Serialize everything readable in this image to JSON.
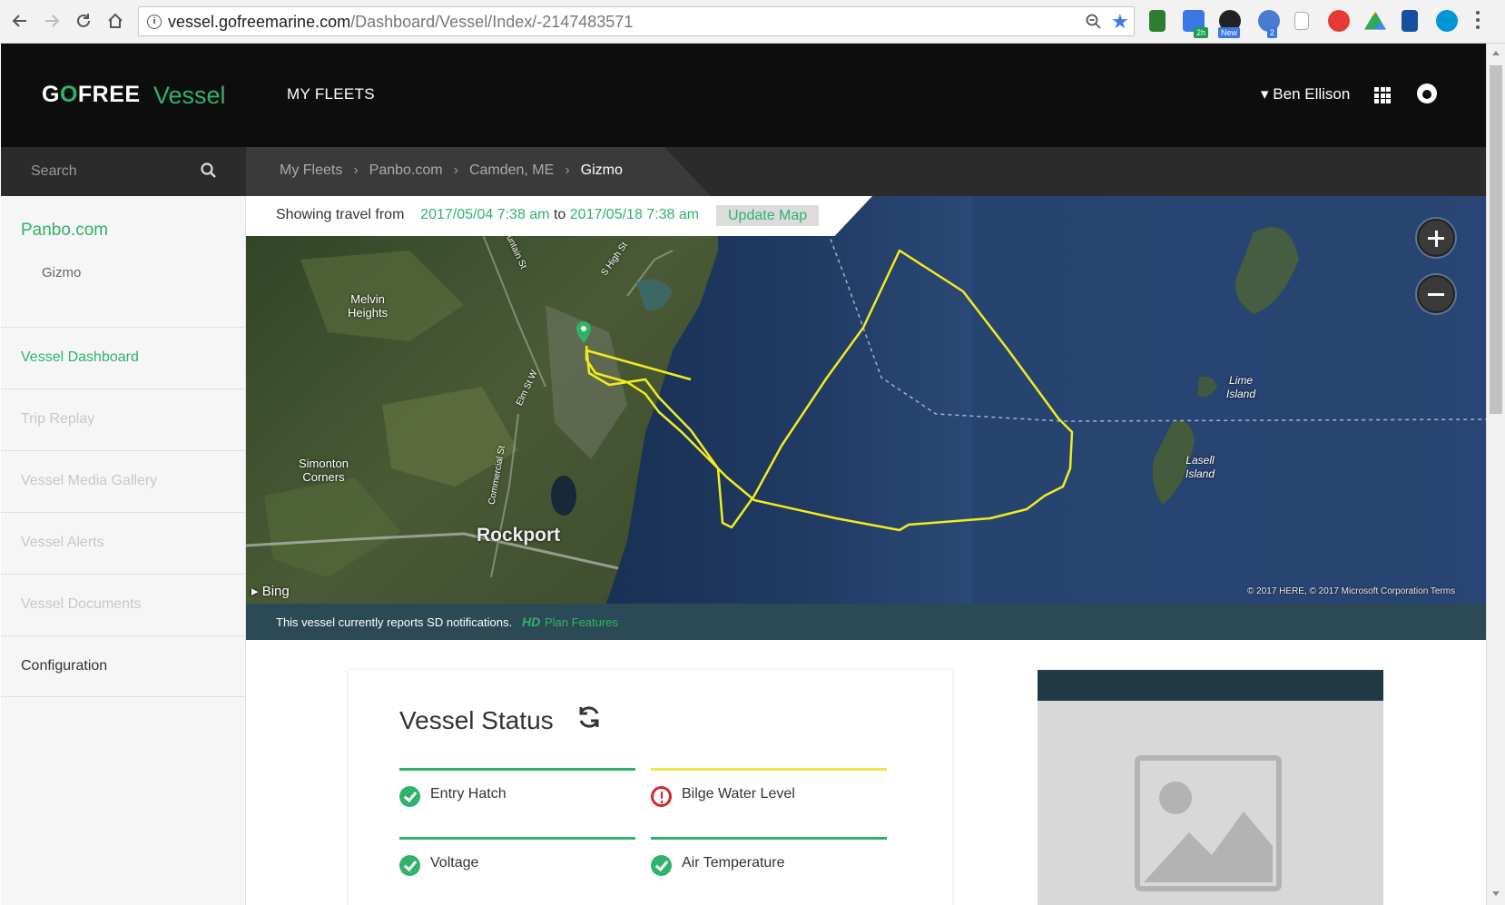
{
  "browser": {
    "url_host": "vessel.gofreemarine.com",
    "url_path": "/Dashboard/Vessel/Index/-2147483571",
    "extension_badges": [
      "2h",
      "New",
      "2"
    ]
  },
  "header": {
    "logo_text_a": "G",
    "logo_text_o": "O",
    "logo_text_b": "FREE",
    "logo_sub": "Vessel",
    "nav_fleets": "MY FLEETS",
    "user_name": "Ben Ellison",
    "user_caret": "▾"
  },
  "search": {
    "placeholder": "Search"
  },
  "breadcrumb": {
    "items": [
      "My Fleets",
      "Panbo.com",
      "Camden, ME"
    ],
    "current": "Gizmo",
    "separator": "›"
  },
  "sidebar": {
    "fleet": "Panbo.com",
    "vessel": "Gizmo",
    "items": [
      {
        "label": "Vessel Dashboard",
        "state": "active"
      },
      {
        "label": "Trip Replay",
        "state": "disabled"
      },
      {
        "label": "Vessel Media Gallery",
        "state": "disabled"
      },
      {
        "label": "Vessel Alerts",
        "state": "disabled"
      },
      {
        "label": "Vessel Documents",
        "state": "disabled"
      },
      {
        "label": "Configuration",
        "state": "normal"
      }
    ]
  },
  "map": {
    "travel_prefix": "Showing travel from",
    "travel_from": "2017/05/04 7:38 am",
    "travel_to_word": "to",
    "travel_to": "2017/05/18 7:38 am",
    "update_button": "Update Map",
    "labels": {
      "melvin": "Melvin\nHeights",
      "simonton": "Simonton\nCorners",
      "rockport": "Rockport",
      "lime": "Lime\nIsland",
      "lasell": "Lasell\nIsland",
      "mountain_st": "Mountain St",
      "s_high_st": "S High St",
      "elm_st": "Elm St W",
      "commercial_st": "Commercial St"
    },
    "attribution": "Bing",
    "copyright": "© 2017 HERE, © 2017 Microsoft Corporation  Terms",
    "track_color": "#f2ec1c"
  },
  "notice": {
    "text": "This vessel currently reports SD notifications.",
    "hd": "HD",
    "link": "Plan Features"
  },
  "vessel_status": {
    "title": "Vessel Status",
    "items": [
      {
        "label": "Entry Hatch",
        "status": "ok",
        "bar_color": "#2fb36b"
      },
      {
        "label": "Bilge Water Level",
        "status": "alert",
        "bar_color": "#f3e44a"
      },
      {
        "label": "Voltage",
        "status": "ok",
        "bar_color": "#2fb36b"
      },
      {
        "label": "Air Temperature",
        "status": "ok",
        "bar_color": "#2fb36b"
      }
    ]
  },
  "colors": {
    "brand_green": "#2fb36b",
    "header_bg": "#0d0d0d",
    "notice_bg": "#2c4a55",
    "alert_red": "#d9262b"
  }
}
